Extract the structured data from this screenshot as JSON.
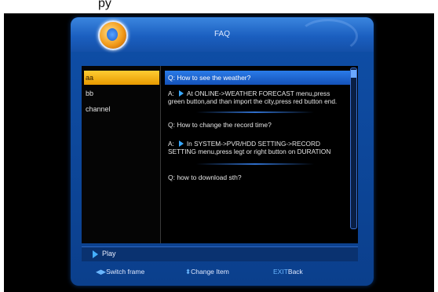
{
  "caption_fragment": "py",
  "header": {
    "title": "FAQ"
  },
  "categories": [
    {
      "label": "aa",
      "selected": true
    },
    {
      "label": "bb",
      "selected": false
    },
    {
      "label": "channel",
      "selected": false
    }
  ],
  "faq": [
    {
      "question": "Q: How to see the weather?",
      "answer_prefix": "A:",
      "answer": "At ONLINE->WEATHER FORECAST menu,press green button,and than import the city,press red button end.",
      "selected": true
    },
    {
      "question": "Q: How to change the record time?",
      "answer_prefix": "A:",
      "answer": "In SYSTEM->PVR/HDD SETTING->RECORD SETTING menu,press legt or right button on DURATION",
      "selected": false
    },
    {
      "question": "Q: how to download sth?",
      "selected": false
    }
  ],
  "play_bar": {
    "label": "Play",
    "icon": "play-icon"
  },
  "footer": {
    "switch_frame": "Switch frame",
    "change_item": "Change Item",
    "exit_key": "EXIT",
    "exit_label": "Back"
  },
  "colors": {
    "panel": "#0f4fa8",
    "selected_category": "#ffcc33",
    "selected_question": "#1f66d6",
    "background": "#000000"
  }
}
